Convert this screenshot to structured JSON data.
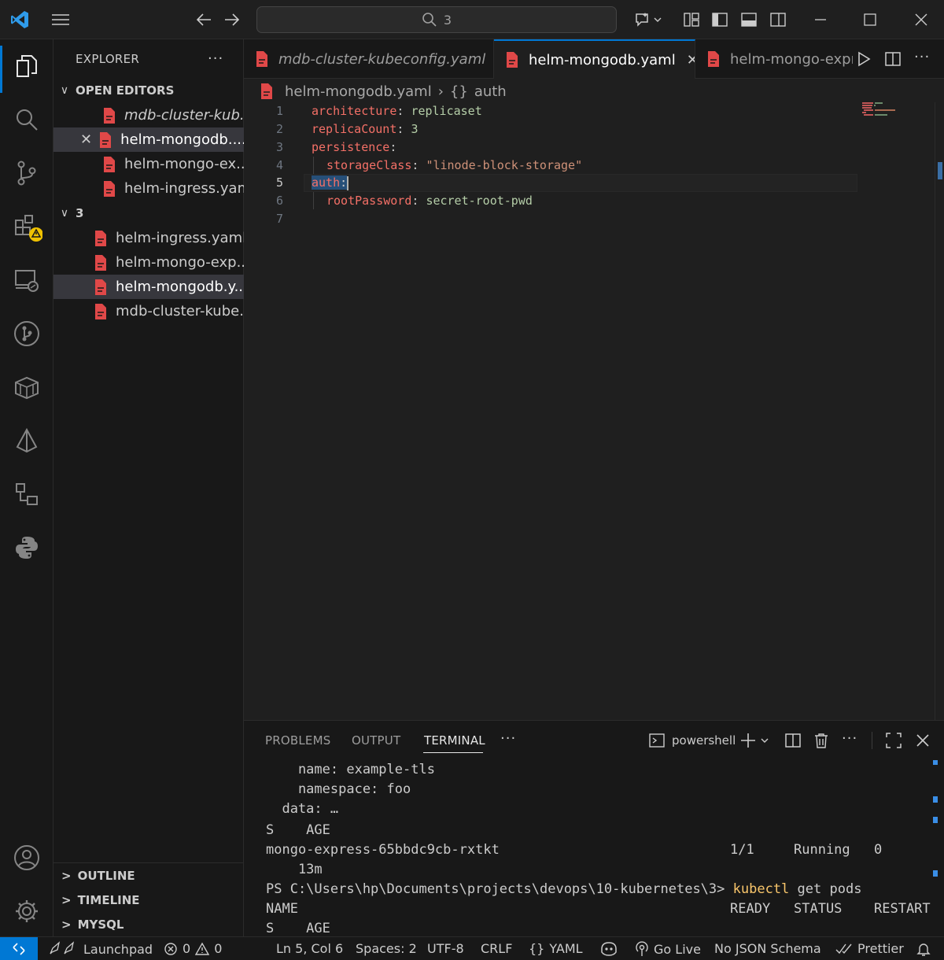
{
  "titlebar": {
    "search_text": "3",
    "colors": {
      "accent": "#0078d4",
      "background": "#1f1f1f"
    }
  },
  "sidebar": {
    "title": "EXPLORER",
    "open_editors_label": "OPEN EDITORS",
    "open_editors": [
      {
        "label": "mdb-cluster-kub...",
        "italic": true
      },
      {
        "label": "helm-mongodb....",
        "selected": true
      },
      {
        "label": "helm-mongo-ex..."
      },
      {
        "label": "helm-ingress.yaml"
      }
    ],
    "folder_label": "3",
    "folder_files": [
      {
        "label": "helm-ingress.yaml"
      },
      {
        "label": "helm-mongo-exp..."
      },
      {
        "label": "helm-mongodb.y...",
        "selected": true
      },
      {
        "label": "mdb-cluster-kube..."
      }
    ],
    "bottom_sections": [
      "OUTLINE",
      "TIMELINE",
      "MYSQL"
    ]
  },
  "tabs": [
    {
      "label": "mdb-cluster-kubeconfig.yaml",
      "italic": true
    },
    {
      "label": "helm-mongodb.yaml",
      "active": true
    },
    {
      "label": "helm-mongo-expr"
    }
  ],
  "breadcrumb": {
    "file": "helm-mongodb.yaml",
    "symbol": "auth"
  },
  "editor": {
    "line_numbers": [
      "1",
      "2",
      "3",
      "4",
      "5",
      "6",
      "7"
    ],
    "current_line": "5",
    "lines": [
      {
        "key": "architecture",
        "value": "replicaset"
      },
      {
        "key": "replicaCount",
        "value": "3"
      },
      {
        "key": "persistence",
        "value": ""
      },
      {
        "key": "storageClass",
        "value": "\"linode-block-storage\""
      },
      {
        "key": "auth",
        "value": ""
      },
      {
        "key": "rootPassword",
        "value": "secret-root-pwd"
      },
      {
        "key": "",
        "value": ""
      }
    ]
  },
  "panel": {
    "tabs": [
      "PROBLEMS",
      "OUTPUT",
      "TERMINAL"
    ],
    "active_tab": "TERMINAL",
    "shell": "powershell",
    "terminal_lines": [
      "    name: example-tls",
      "    namespace: foo",
      "  data: …",
      "S    AGE",
      "mongo-express-65bbdc9cb-rxtkt",
      "    13m",
      "NAME",
      "S    AGE"
    ],
    "pod_ready": "1/1",
    "pod_status": "Running",
    "pod_restarts": "0",
    "prompt": "PS C:\\Users\\hp\\Documents\\projects\\devops\\10-kubernetes\\3>",
    "command_name": "kubectl",
    "command_args": "get pods",
    "header_ready": "READY",
    "header_status": "STATUS",
    "header_restart": "RESTART"
  },
  "statusbar": {
    "launchpad": "Launchpad",
    "errors": "0",
    "warnings": "0",
    "position": "Ln 5, Col 6",
    "spaces": "Spaces: 2",
    "encoding": "UTF-8",
    "eol": "CRLF",
    "language": "YAML",
    "go_live": "Go Live",
    "schema": "No JSON Schema",
    "prettier": "Prettier"
  }
}
